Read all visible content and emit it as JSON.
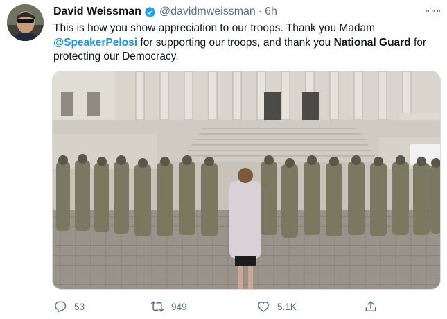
{
  "tweet": {
    "author": {
      "display_name": "David Weissman",
      "verified_icon": "verified-badge-icon",
      "handle": "@davidmweissman",
      "separator": "·",
      "time": "6h"
    },
    "text": {
      "part1": "This is how you show appreciation to our troops. Thank you Madam ",
      "mention": "@SpeakerPelosi",
      "part2": " for supporting our troops, and thank you ",
      "bold": "National Guard",
      "part3": " for protecting our Democracy."
    },
    "actions": {
      "reply_count": "53",
      "retweet_count": "949",
      "like_count": "5.1K"
    },
    "colors": {
      "accent": "#1b95e0",
      "secondary_text": "#5b7083",
      "verified": "#1da1f2"
    },
    "icons": [
      "more-icon",
      "reply-icon",
      "retweet-icon",
      "like-icon",
      "share-icon"
    ]
  }
}
